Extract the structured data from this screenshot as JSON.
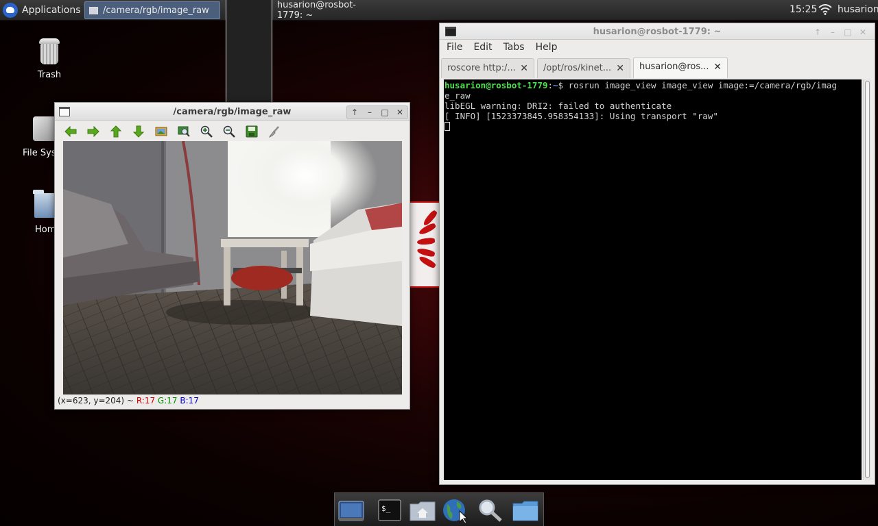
{
  "panel": {
    "applications_label": "Applications",
    "tasks": [
      {
        "label": "/camera/rgb/image_raw",
        "active": true
      },
      {
        "label": "husarion@rosbot-1779: ~",
        "active": false
      }
    ],
    "clock": "15:25",
    "user": "husarion"
  },
  "desktop": {
    "icons": [
      {
        "label": "Trash",
        "icon": "trash-icon"
      },
      {
        "label": "File Sys",
        "icon": "drive-icon"
      },
      {
        "label": "Hom",
        "icon": "home-folder-icon"
      }
    ]
  },
  "image_view": {
    "title": "/camera/rgb/image_raw",
    "toolbar": [
      "back-arrow-icon",
      "forward-arrow-icon",
      "up-arrow-icon",
      "down-arrow-icon",
      "image-icon",
      "zoom-fit-icon",
      "zoom-in-icon",
      "zoom-out-icon",
      "save-icon",
      "brush-icon"
    ],
    "status": {
      "coords": "(x=623, y=204) ~",
      "r": "R:17",
      "g": "G:17",
      "b": "B:17"
    }
  },
  "terminal": {
    "title": "husarion@rosbot-1779: ~",
    "menu": [
      "File",
      "Edit",
      "Tabs",
      "Help"
    ],
    "tabs": [
      {
        "label": "roscore http:/...",
        "active": false
      },
      {
        "label": "/opt/ros/kinet...",
        "active": false
      },
      {
        "label": "husarion@ros...",
        "active": true
      }
    ],
    "lines": {
      "prompt_user": "husarion@rosbot-1779",
      "prompt_sep": ":",
      "prompt_path": "~",
      "prompt_dollar": "$ ",
      "command": "rosrun image_view image_view image:=/camera/rgb/imag",
      "command_wrap": "e_raw",
      "warning": "libEGL warning: DRI2: failed to authenticate",
      "info": "[ INFO] [1523373845.958354133]: Using transport \"raw\""
    }
  },
  "dock": [
    "desktop-icon",
    "terminal-icon",
    "home-icon",
    "web-browser-icon",
    "search-icon",
    "folder-icon"
  ],
  "colors": {
    "prompt_user": "#4fe34f",
    "prompt_path": "#5a8ce8",
    "status_r": "#d00000",
    "status_g": "#009000",
    "status_b": "#0000d0"
  }
}
